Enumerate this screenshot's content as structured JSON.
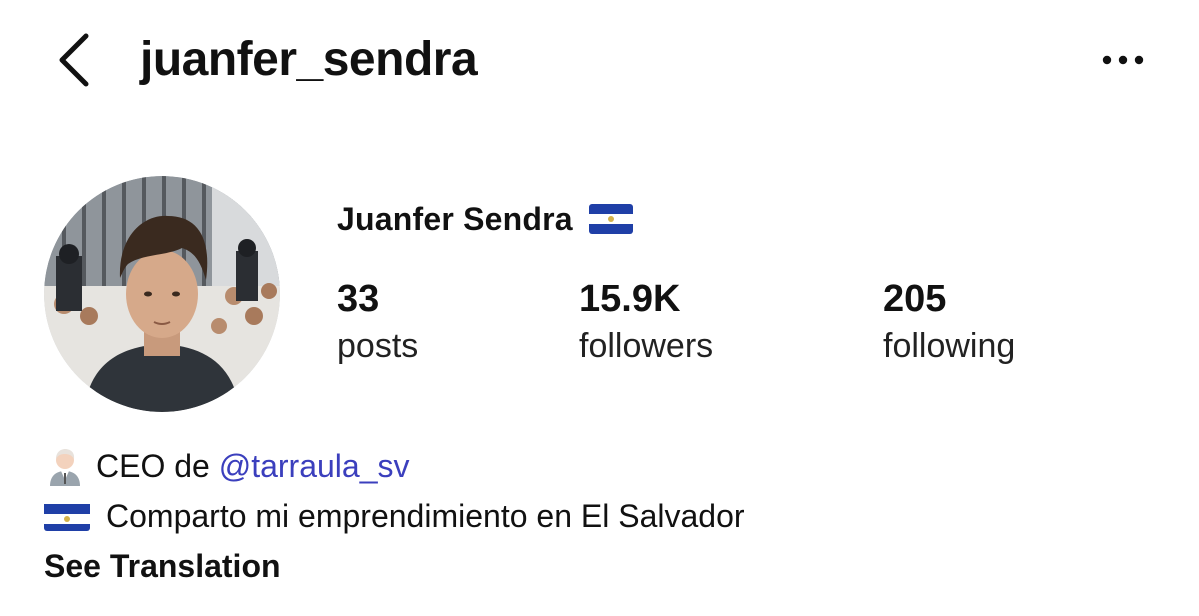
{
  "header": {
    "back_icon": "chevron-left-icon",
    "username": "juanfer_sendra",
    "more_icon": "more-horizontal-icon"
  },
  "profile": {
    "display_name": "Juanfer Sendra",
    "flag_icon": "el-salvador-flag-icon",
    "stats": {
      "posts": {
        "value": "33",
        "label": "posts"
      },
      "followers": {
        "value": "15.9K",
        "label": "followers"
      },
      "following": {
        "value": "205",
        "label": "following"
      }
    }
  },
  "bio": {
    "line1_icon": "businessman-emoji-icon",
    "line1_prefix": "CEO de ",
    "line1_mention": "@tarraula_sv",
    "line2_icon": "el-salvador-flag-icon",
    "line2_text": "Comparto mi emprendimiento en El Salvador",
    "see_translation": "See Translation"
  },
  "colors": {
    "mention": "#3b3fbd",
    "flag_blue": "#1f3fa7",
    "text": "#111111"
  }
}
